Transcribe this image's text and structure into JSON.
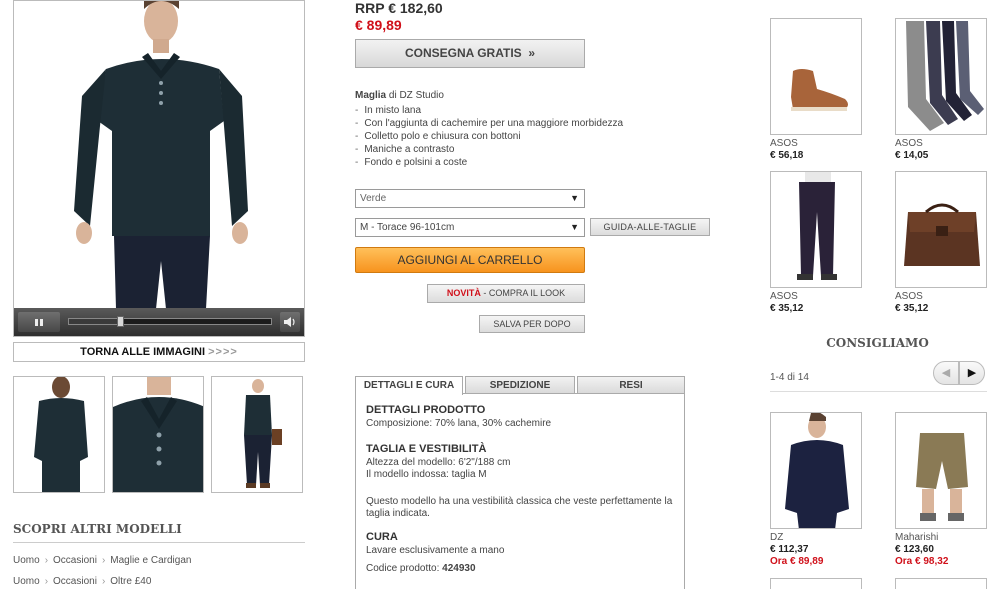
{
  "gallery": {
    "back_to_images": "TORNA ALLE IMMAGINI",
    "back_arrows": ">>>>"
  },
  "explore": {
    "title": "SCOPRI ALTRI MODELLI",
    "breadcrumbs": [
      [
        "Uomo",
        "Occasioni",
        "Maglie e Cardigan"
      ],
      [
        "Uomo",
        "Occasioni",
        "Oltre £40"
      ]
    ]
  },
  "product": {
    "rrp": "RRP € 182,60",
    "price": "€ 89,89",
    "free_delivery": "CONSEGNA GRATIS",
    "free_delivery_arrow": "»",
    "desc_name": "Maglia",
    "desc_by": " di DZ Studio",
    "bullets": [
      "In misto lana",
      "Con l'aggiunta di cachemire per una maggiore morbidezza",
      "Colletto polo e chiusura con bottoni",
      "Maniche a contrasto",
      "Fondo e polsini a coste"
    ],
    "colour": "Verde",
    "size": "M - Torace 96-101cm",
    "size_guide": "GUIDA-ALLE-TAGLIE",
    "add_to_cart": "AGGIUNGI AL CARRELLO",
    "new_label": "NOVITÀ",
    "shop_look": " - COMPRA IL LOOK",
    "save_later": "SALVA PER DOPO"
  },
  "tabs": [
    "DETTAGLI E CURA",
    "SPEDIZIONE",
    "RESI"
  ],
  "details": {
    "h1": "DETTAGLI PRODOTTO",
    "composition": "Composizione: 70% lana, 30% cachemire",
    "h2": "TAGLIA E VESTIBILITÀ",
    "model_height": "Altezza del modello: 6'2\"/188 cm",
    "model_size": "Il modello indossa: taglia M",
    "fit_line1": "Questo modello ha una vestibilità classica che veste perfettamente la",
    "fit_line2": "taglia indicata.",
    "h3": "CURA",
    "care": "Lavare esclusivamente a mano",
    "code_label": "Codice prodotto: ",
    "code": "424930"
  },
  "related": [
    {
      "brand": "ASOS",
      "price": "€ 56,18"
    },
    {
      "brand": "ASOS",
      "price": "€ 14,05"
    },
    {
      "brand": "ASOS",
      "price": "€ 35,12"
    },
    {
      "brand": "ASOS",
      "price": "€ 35,12"
    }
  ],
  "recommend": {
    "title": "CONSIGLIAMO",
    "pager": "1-4 di 14",
    "items": [
      {
        "brand": "DZ",
        "price": "€ 112,37",
        "sale": "Ora € 89,89"
      },
      {
        "brand": "Maharishi",
        "price": "€ 123,60",
        "sale": "Ora € 98,32"
      }
    ]
  },
  "colors": {
    "price_red": "#d0101a",
    "cta_orange": "#f7931e",
    "sweater": "#1e2e36",
    "jeans": "#1b2233"
  },
  "icons": [
    "pause-icon",
    "volume-icon",
    "chevron-left-icon",
    "chevron-right-icon",
    "dropdown-caret-icon"
  ]
}
